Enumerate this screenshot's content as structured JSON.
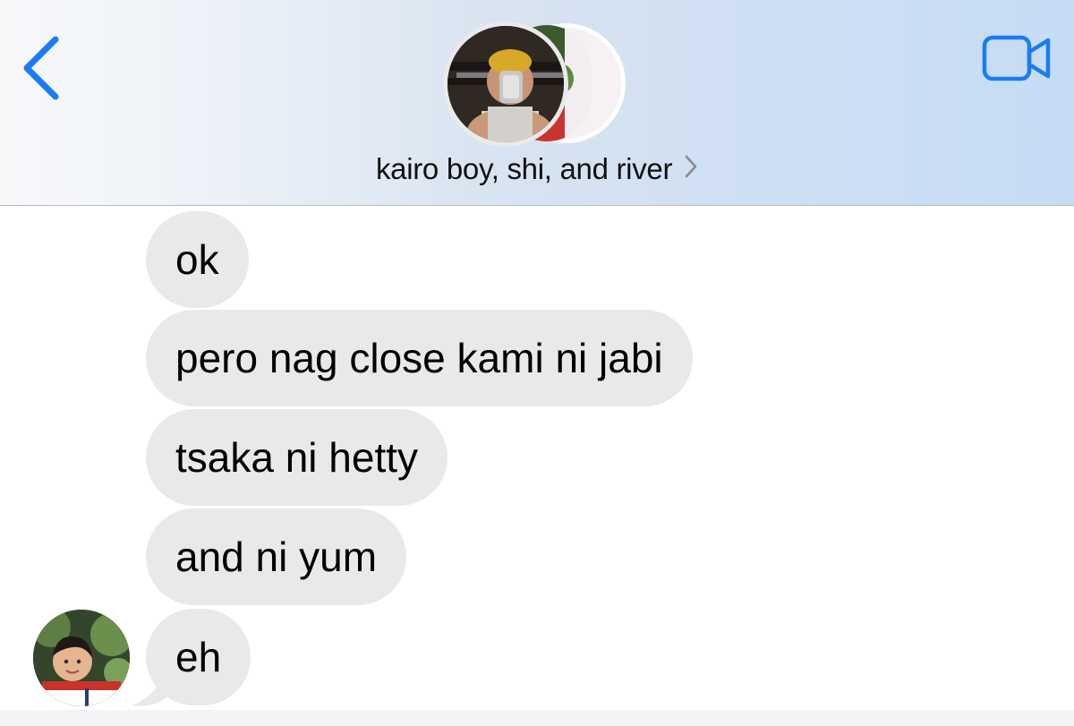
{
  "header": {
    "back_icon": "chevron-left-icon",
    "video_icon": "video-camera-icon",
    "group_title": "kairo boy, shi, and river",
    "accent_color": "#1a7cf5"
  },
  "messages": [
    {
      "text": "ok"
    },
    {
      "text": "pero nag close kami ni jabi"
    },
    {
      "text": "tsaka ni hetty"
    },
    {
      "text": "and ni yum"
    },
    {
      "text": "eh"
    }
  ],
  "colors": {
    "bubble_received": "#e9e9eb",
    "header_gradient_end": "#c6dcf5"
  }
}
